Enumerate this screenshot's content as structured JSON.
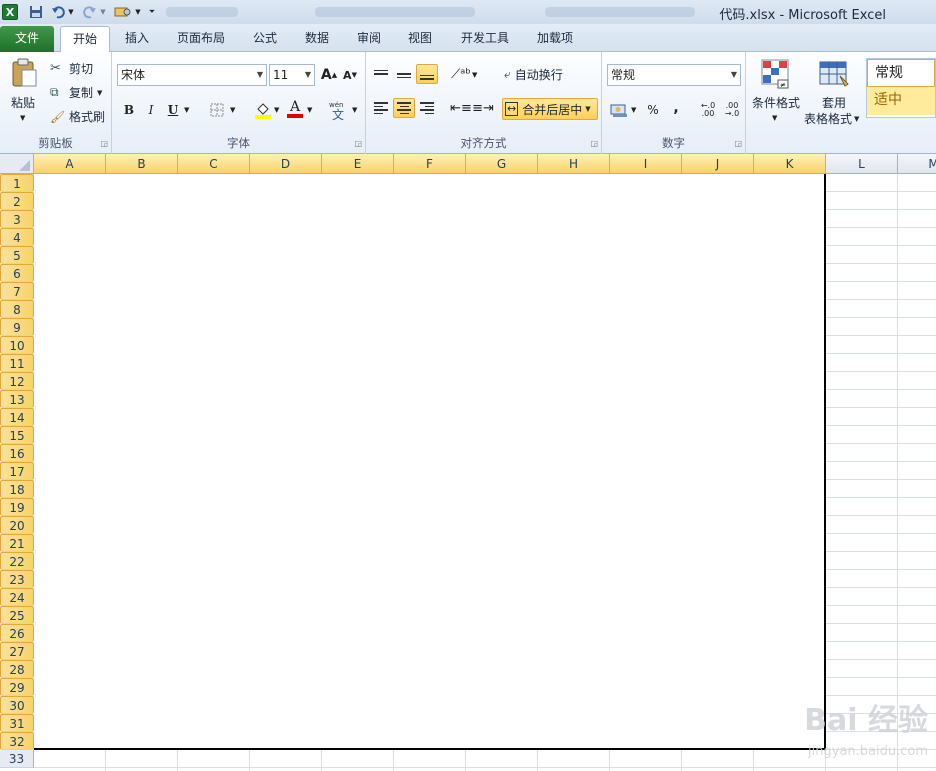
{
  "window": {
    "title": "代码.xlsx - Microsoft Excel"
  },
  "colors": {
    "accent": "#1f6f2a",
    "selected_header": "#f7d36a",
    "neutral_style": "#ffeb9c"
  },
  "tabs": [
    {
      "label": "文件"
    },
    {
      "label": "开始"
    },
    {
      "label": "插入"
    },
    {
      "label": "页面布局"
    },
    {
      "label": "公式"
    },
    {
      "label": "数据"
    },
    {
      "label": "审阅"
    },
    {
      "label": "视图"
    },
    {
      "label": "开发工具"
    },
    {
      "label": "加载项"
    }
  ],
  "ribbon": {
    "clipboard": {
      "label": "剪贴板",
      "paste": "粘贴",
      "cut": "剪切",
      "copy": "复制",
      "format_painter": "格式刷"
    },
    "font": {
      "label": "字体",
      "font_name": "宋体",
      "font_size": "11",
      "bold": "B",
      "italic": "I",
      "underline": "U",
      "grow": "A",
      "shrink": "A",
      "font_color": "A"
    },
    "alignment": {
      "label": "对齐方式",
      "wrap_text": "自动换行",
      "merge_center": "合并后居中"
    },
    "number": {
      "label": "数字",
      "format": "常规",
      "percent": "%",
      "comma": ",",
      "inc_decimal": "←.0 .00",
      "dec_decimal": ".00 →.0"
    },
    "styles": {
      "conditional": "条件格式",
      "table_format_1": "套用",
      "table_format_2": "表格格式",
      "normal": "常规",
      "neutral": "适中"
    }
  },
  "sheet": {
    "columns": [
      "A",
      "B",
      "C",
      "D",
      "E",
      "F",
      "G",
      "H",
      "I",
      "J",
      "K",
      "L",
      "M"
    ],
    "selected_columns": 11,
    "rows": [
      "1",
      "2",
      "3",
      "4",
      "5",
      "6",
      "7",
      "8",
      "9",
      "10",
      "11",
      "12",
      "13",
      "14",
      "15",
      "16",
      "17",
      "18",
      "19",
      "20",
      "21",
      "22",
      "23",
      "24",
      "25",
      "26",
      "27",
      "28",
      "29",
      "30",
      "31",
      "32",
      "33"
    ],
    "selected_rows": 32
  },
  "watermark": {
    "line1": "Bai 经验",
    "line2": "jingyan.baidu.com"
  }
}
